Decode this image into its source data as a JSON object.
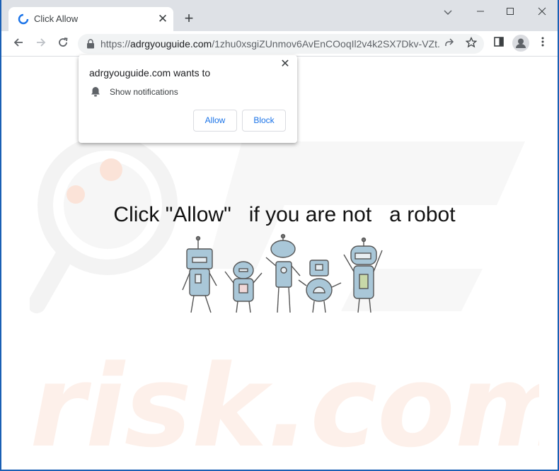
{
  "tab": {
    "title": "Click Allow",
    "close_icon": "close-icon",
    "new_tab_icon": "plus-icon"
  },
  "window_controls": {
    "minimize_icon": "minimize-icon",
    "maximize_icon": "maximize-icon",
    "close_icon": "close-icon",
    "tab_search_icon": "chevron-down-icon"
  },
  "toolbar": {
    "back_icon": "arrow-left-icon",
    "forward_icon": "arrow-right-icon",
    "reload_icon": "reload-icon",
    "url_scheme": "https://",
    "url_host": "adrgyouguide.com",
    "url_path": "/1zhu0xsgiZUnmov6AvEnCOoqIl2v4k2SX7Dkv-VZt...",
    "share_icon": "share-icon",
    "bookmark_icon": "star-icon",
    "side_panel_icon": "side-panel-icon",
    "profile_icon": "avatar-icon",
    "menu_icon": "more-vert-icon"
  },
  "popup": {
    "title": "adrgyouguide.com wants to",
    "permission": "Show notifications",
    "bell_icon": "bell-icon",
    "allow_label": "Allow",
    "block_label": "Block"
  },
  "page": {
    "headline": "Click \"Allow\"   if you are not   a robot",
    "watermark_text": "risk.com"
  },
  "colors": {
    "tabbar": "#dee1e6",
    "link_blue": "#1a73e8",
    "window_border": "#1a5fb4",
    "watermark": "#fbe3d8"
  }
}
